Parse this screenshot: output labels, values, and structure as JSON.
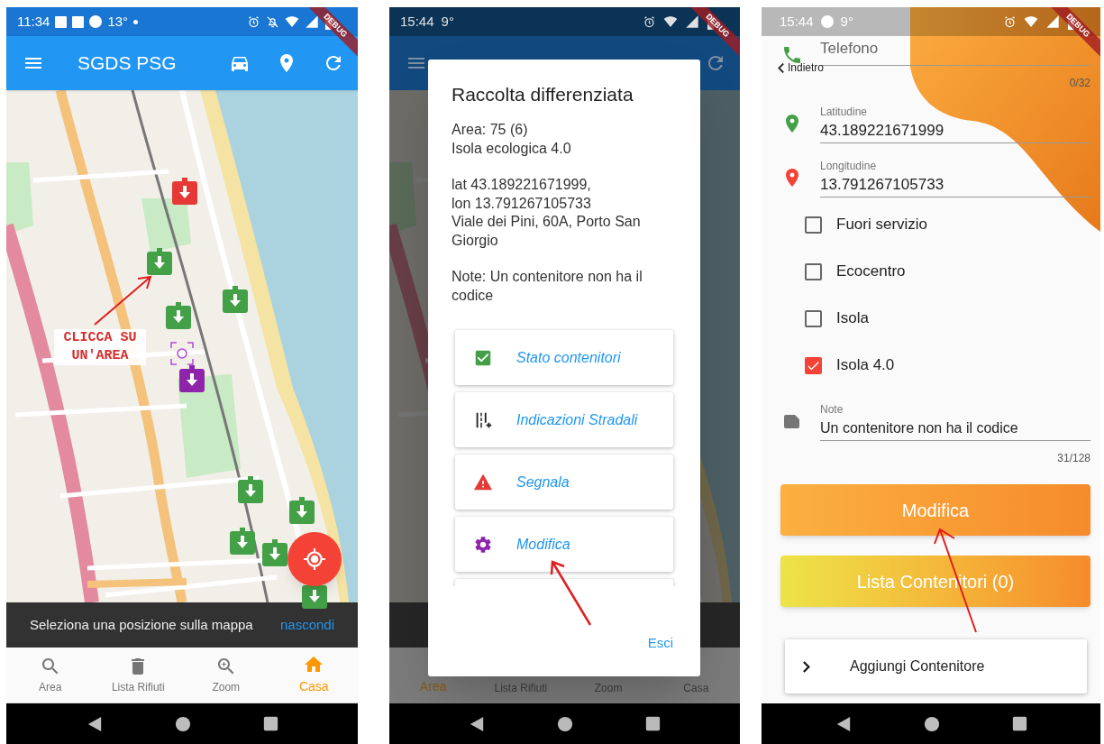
{
  "map_screen": {
    "status_bar": {
      "time": "11:34",
      "temperature": "13°"
    },
    "app_bar": {
      "title": "SGDS PSG"
    },
    "map": {
      "annotation": "CLICCA SU UN'AREA",
      "markers": [
        {
          "color": "#e53935"
        },
        {
          "color": "#43a047"
        },
        {
          "color": "#43a047"
        },
        {
          "color": "#43a047"
        },
        {
          "color": "#8e24aa"
        },
        {
          "color": "#43a047"
        },
        {
          "color": "#43a047"
        },
        {
          "color": "#43a047"
        },
        {
          "color": "#43a047"
        },
        {
          "color": "#43a047"
        }
      ]
    },
    "snackbar": {
      "message": "Seleziona una posizione sulla mappa",
      "action": "nascondi"
    },
    "bottom_nav": [
      {
        "kind": "search",
        "label": "Area",
        "selected": false
      },
      {
        "kind": "delete",
        "label": "Lista Rifiuti",
        "selected": false
      },
      {
        "kind": "zoom",
        "label": "Zoom",
        "selected": false
      },
      {
        "kind": "home",
        "label": "Casa",
        "selected": true
      }
    ],
    "debug_banner": "DEBUG"
  },
  "dialog_screen": {
    "status_bar": {
      "time": "15:44",
      "temperature": "9°"
    },
    "dialog": {
      "title": "Raccolta differenziata",
      "paragraphs": [
        [
          "Area: 75 (6)",
          "Isola ecologica 4.0"
        ],
        [
          "lat 43.189221671999,",
          "lon 13.791267105733",
          "Viale dei Pini, 60A, Porto San Giorgio"
        ],
        [
          "Note: Un contenitore non ha il codice"
        ]
      ],
      "actions": [
        {
          "kind": "checklist",
          "label": "Stato contenitori",
          "color": "#43a047"
        },
        {
          "kind": "directions",
          "label": "Indicazioni Stradali",
          "color": "#212121"
        },
        {
          "kind": "warning",
          "label": "Segnala",
          "color": "#e53935"
        },
        {
          "kind": "settings",
          "label": "Modifica",
          "color": "#8e24aa"
        }
      ],
      "close_button": "Esci"
    },
    "bottom_nav": [
      {
        "label": "Area",
        "selected": true
      },
      {
        "label": "Lista Rifiuti",
        "selected": false
      },
      {
        "label": "Zoom",
        "selected": false
      },
      {
        "label": "Casa",
        "selected": false
      }
    ],
    "debug_banner": "DEBUG"
  },
  "form_screen": {
    "status_bar": {
      "time": "15:44",
      "temperature": "9°"
    },
    "phone_field": {
      "placeholder": "Telefono",
      "counter": "0/32"
    },
    "back_button": "Indietro",
    "latitude": {
      "label": "Latitudine",
      "value": "43.189221671999"
    },
    "longitude": {
      "label": "Longitudine",
      "value": "13.791267105733"
    },
    "checkboxes": [
      {
        "label": "Fuori servizio",
        "checked": false
      },
      {
        "label": "Ecocentro",
        "checked": false
      },
      {
        "label": "Isola",
        "checked": false
      },
      {
        "label": "Isola 4.0",
        "checked": true
      }
    ],
    "note": {
      "label": "Note",
      "value": "Un contenitore non ha il codice",
      "counter": "31/128"
    },
    "buttons": [
      "Modifica",
      "Lista Contenitori (0)"
    ],
    "add_card": "Aggiungi Contenitore",
    "debug_banner": "DEBUG"
  }
}
